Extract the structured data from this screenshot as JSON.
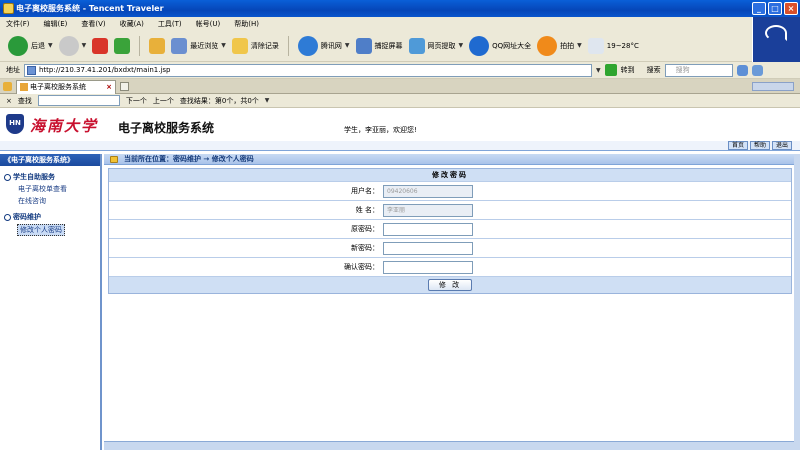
{
  "window": {
    "title": "电子离校服务系统 - Tencent Traveler"
  },
  "menu": [
    "文件(F)",
    "编辑(E)",
    "查看(V)",
    "收藏(A)",
    "工具(T)",
    "帐号(U)",
    "帮助(H)"
  ],
  "toolbar": {
    "back": "后退",
    "recent": "最近浏览",
    "clear": "清除记录",
    "reader": "腾讯网",
    "screenshot": "捕捉屏幕",
    "webpage": "网页提取",
    "qq_url": "QQ网址大全",
    "pat": "拍拍",
    "weather": "19~28°C"
  },
  "address": {
    "label": "地址",
    "url": "http://210.37.41.201/bxdxt/main1.jsp",
    "go": "转到",
    "search_label": "搜索",
    "search_placeholder": "搜狗"
  },
  "tabs": [
    {
      "label": "电子离校服务系统"
    }
  ],
  "find": {
    "label": "查找",
    "next": "下一个",
    "prev": "上一个",
    "result": "查找结果：第0个，共0个"
  },
  "banner": {
    "emblem": "HN",
    "university": "海南大学",
    "system": "电子离校服务系统",
    "welcome": "学生，李亚丽，欢迎您!"
  },
  "utils": [
    "首页",
    "帮助",
    "退出"
  ],
  "sidebar": {
    "header": "《电子离校服务系统》",
    "groups": [
      {
        "title": "学生自助服务",
        "items": [
          "电子离校单查看",
          "在线咨询"
        ]
      },
      {
        "title": "密码维护",
        "items": [
          "修改个人密码"
        ]
      }
    ]
  },
  "content": {
    "breadcrumb": "当前所在位置：密码维护 → 修改个人密码",
    "form": {
      "title": "修改密码",
      "fields": [
        {
          "label": "用户名：",
          "value": "09420606"
        },
        {
          "label": "姓  名：",
          "value": "李亚丽"
        },
        {
          "label": "原密码：",
          "value": ""
        },
        {
          "label": "新密码：",
          "value": ""
        },
        {
          "label": "确认密码：",
          "value": ""
        }
      ],
      "submit": "修 改"
    }
  }
}
